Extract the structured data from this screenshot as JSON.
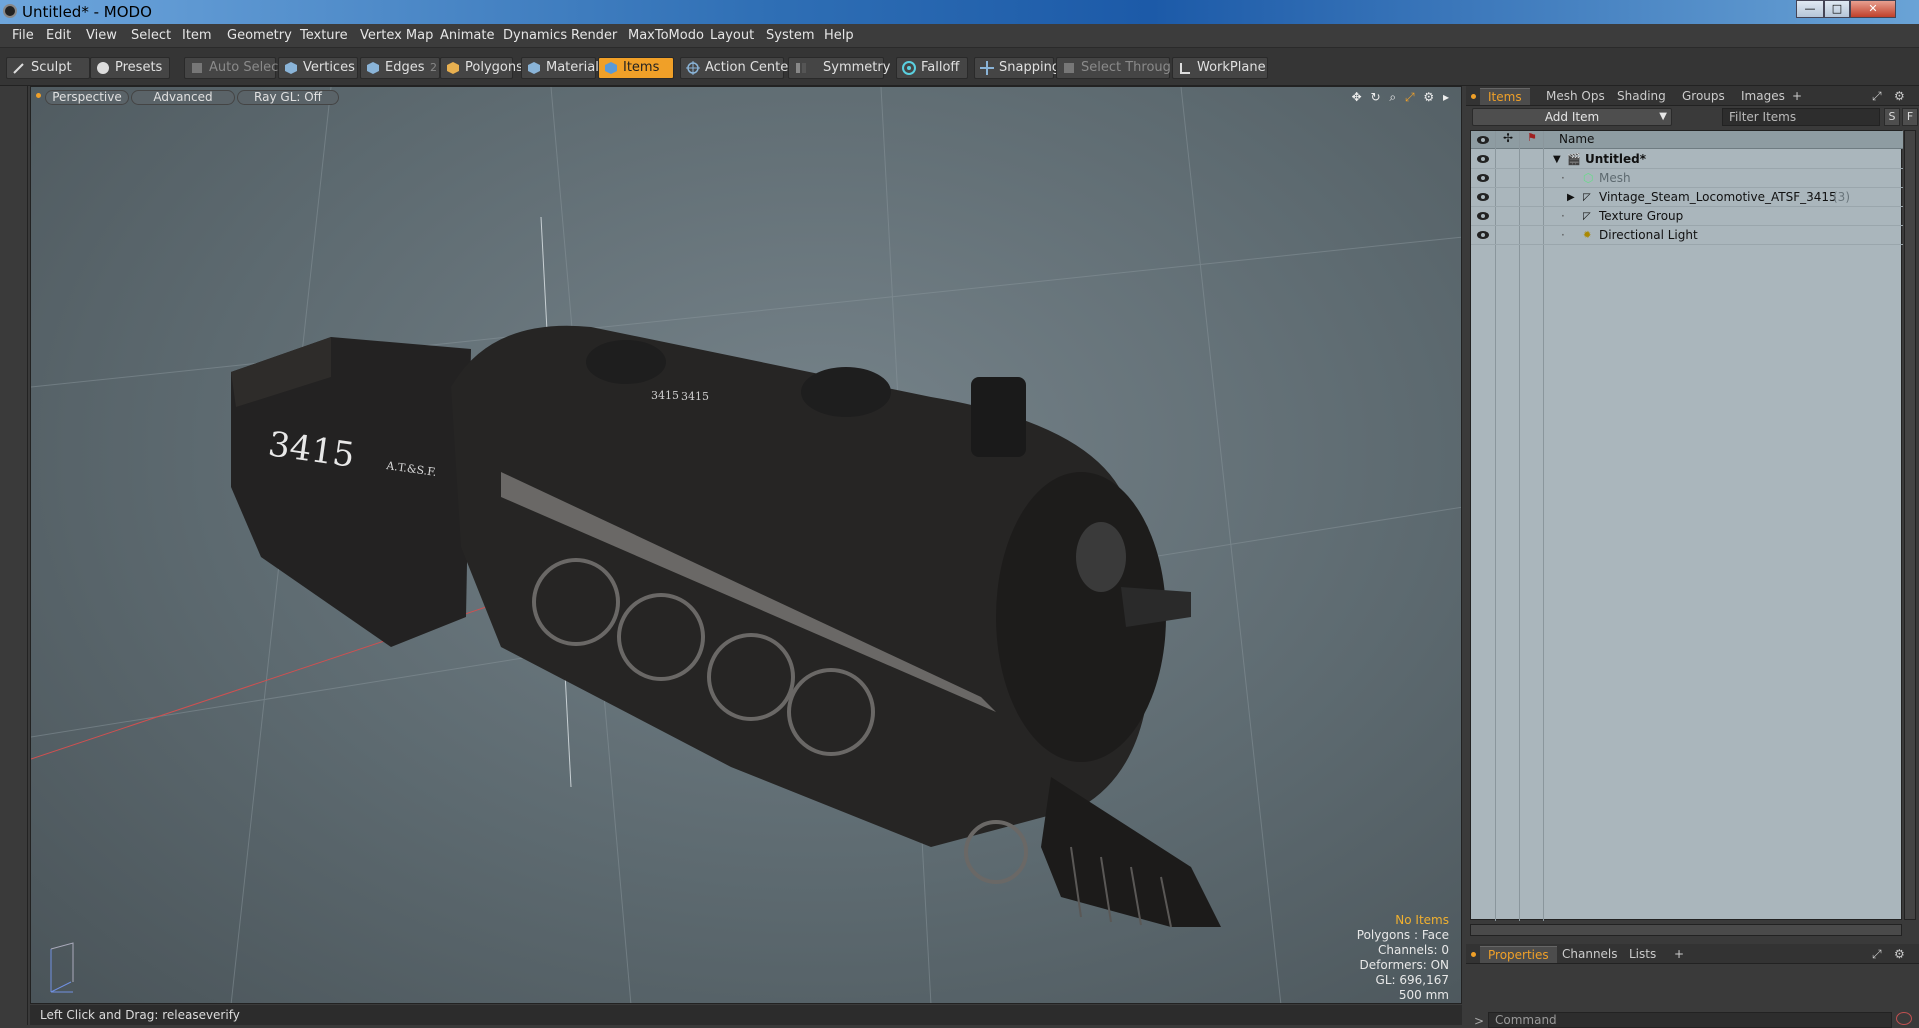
{
  "window": {
    "title": "Untitled* - MODO",
    "minimize": "—",
    "maximize": "□",
    "close": "✕"
  },
  "menu": [
    "File",
    "Edit",
    "View",
    "Select",
    "Item",
    "Geometry",
    "Texture",
    "Vertex Map",
    "Animate",
    "Dynamics",
    "Render",
    "MaxToModo",
    "Layout",
    "System",
    "Help"
  ],
  "toolbar": {
    "sculpt": "Sculpt",
    "presets": "Presets",
    "auto_select": "Auto Select",
    "vertices": "Vertices",
    "edges": "Edges",
    "edges_count": "2",
    "polygons": "Polygons",
    "materials": "Materials",
    "items": "Items",
    "action_center": "Action Center",
    "symmetry": "Symmetry",
    "falloff": "Falloff",
    "snapping": "Snapping",
    "select_through": "Select Through",
    "workplane": "WorkPlane"
  },
  "viewport": {
    "view": "Perspective",
    "shading": "Advanced",
    "raygl": "Ray GL: Off",
    "locomotive_numbers": "3415",
    "tender_text": "A.T.&S.F.",
    "stats": {
      "selection": "No Items",
      "polygons": "Polygons : Face",
      "channels": "Channels: 0",
      "deformers": "Deformers: ON",
      "gl": "GL: 696,167",
      "scale": "500 mm"
    }
  },
  "status": "Left Click and Drag:  releaseverify",
  "panel": {
    "tabs": [
      "Items",
      "Mesh Ops",
      "Shading",
      "Groups",
      "Images"
    ],
    "add_item": "Add Item",
    "filter_placeholder": "Filter Items",
    "s_btn": "S",
    "f_btn": "F",
    "col_name": "Name",
    "tree": [
      {
        "label": "Untitled*",
        "suffix": ""
      },
      {
        "label": "Mesh",
        "suffix": ""
      },
      {
        "label": "Vintage_Steam_Locomotive_ATSF_3415",
        "suffix": "(3)"
      },
      {
        "label": "Texture Group",
        "suffix": ""
      },
      {
        "label": "Directional Light",
        "suffix": ""
      }
    ],
    "bottom_tabs": [
      "Properties",
      "Channels",
      "Lists"
    ],
    "command_placeholder": "Command"
  },
  "colors": {
    "accent": "#f0a028",
    "viewport_bg": "#5d6a70",
    "tree_bg": "#aab6bc"
  }
}
